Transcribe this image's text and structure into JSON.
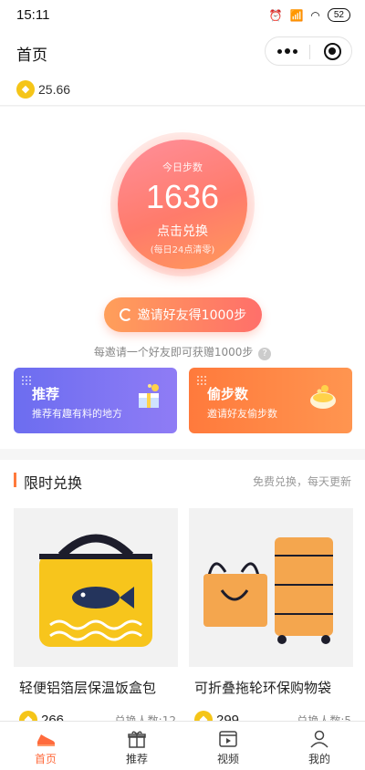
{
  "status_bar": {
    "time": "15:11",
    "battery": "52"
  },
  "nav": {
    "title": "首页"
  },
  "wallet": {
    "balance": "25.66"
  },
  "steps": {
    "today_label": "今日步数",
    "count": "1636",
    "action": "点击兑换",
    "reset_note": "(每日24点清零)"
  },
  "invite": {
    "button_label": "邀请好友得1000步",
    "tip": "每邀请一个好友即可获赠1000步",
    "help": "?"
  },
  "promos": [
    {
      "title": "推荐",
      "subtitle": "推荐有趣有料的地方"
    },
    {
      "title": "偷步数",
      "subtitle": "邀请好友偷步数"
    }
  ],
  "limited": {
    "title": "限时兑换",
    "subtitle": "免费兑换，每天更新",
    "products": [
      {
        "name": "轻便铝箔层保温饭盒包",
        "price": "266",
        "exchanged": "兑换人数:12"
      },
      {
        "name": "可折叠拖轮环保购物袋",
        "price": "299",
        "exchanged": "兑换人数:5"
      }
    ]
  },
  "tabbar": [
    {
      "label": "首页",
      "icon": "shoe-icon",
      "active": true
    },
    {
      "label": "推荐",
      "icon": "gift-icon",
      "active": false
    },
    {
      "label": "视频",
      "icon": "video-icon",
      "active": false
    },
    {
      "label": "我的",
      "icon": "user-icon",
      "active": false
    }
  ],
  "colors": {
    "accent": "#ff6b3d",
    "promo_blue": "#6c6df0",
    "promo_orange": "#ff7a3c"
  }
}
